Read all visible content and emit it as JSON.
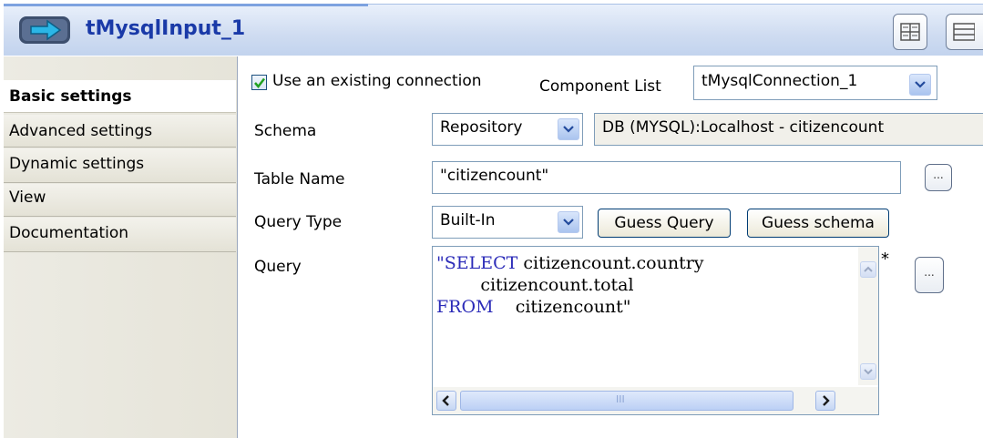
{
  "title": {
    "text": "tMysqlInput_1",
    "icon": "component-arrow-icon"
  },
  "tabs": [
    {
      "label": "Basic settings",
      "active": true
    },
    {
      "label": "Advanced settings"
    },
    {
      "label": "Dynamic settings"
    },
    {
      "label": "View"
    },
    {
      "label": "Documentation"
    }
  ],
  "basic": {
    "use_existing_label": "Use an existing connection",
    "use_existing_checked": true,
    "component_list_label": "Component List",
    "component_list_value": "tMysqlConnection_1",
    "schema_label": "Schema",
    "schema_type": "Repository",
    "schema_value": "DB (MYSQL):Localhost - citizencount",
    "table_name_label": "Table Name",
    "table_name_value": "\"citizencount\"",
    "query_type_label": "Query Type",
    "query_type_value": "Built-In",
    "guess_query_label": "Guess Query",
    "guess_schema_label": "Guess schema",
    "query_label": "Query",
    "query_asterisk": "*",
    "query_lines": [
      {
        "kw": "\"SELECT",
        "rest": " citizencount.country"
      },
      {
        "kw": "",
        "rest": "        citizencount.total"
      },
      {
        "kw": "FROM",
        "rest": "    citizencount\""
      }
    ],
    "dots_label": "...",
    "scroll_thumb_grip": "III"
  },
  "colors": {
    "title_text": "#1a3aa8",
    "keyword": "#2b2bb8"
  }
}
